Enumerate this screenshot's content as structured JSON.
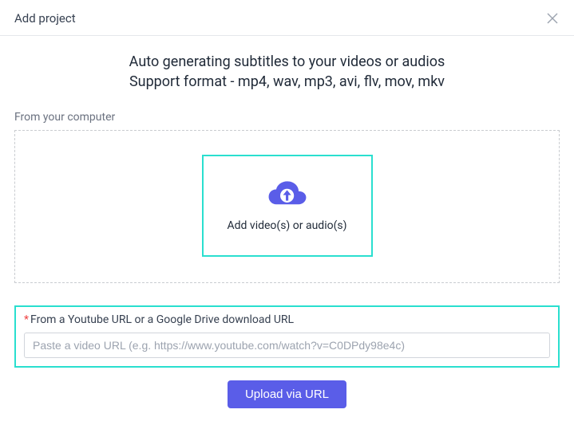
{
  "dialog": {
    "title": "Add project"
  },
  "headline": {
    "line1": "Auto generating subtitles to your videos or audios",
    "line2": "Support format - mp4, wav, mp3, avi, flv, mov, mkv"
  },
  "fromComputer": {
    "label": "From your computer",
    "dropText": "Add video(s) or audio(s)"
  },
  "urlSection": {
    "asterisk": "*",
    "label": "From a Youtube URL or a Google Drive download URL",
    "placeholder": "Paste a video URL (e.g. https://www.youtube.com/watch?v=C0DPdy98e4c)",
    "value": ""
  },
  "buttons": {
    "uploadViaUrl": "Upload via URL"
  },
  "colors": {
    "accentTeal": "#2adfcf",
    "primary": "#5a5de8"
  }
}
